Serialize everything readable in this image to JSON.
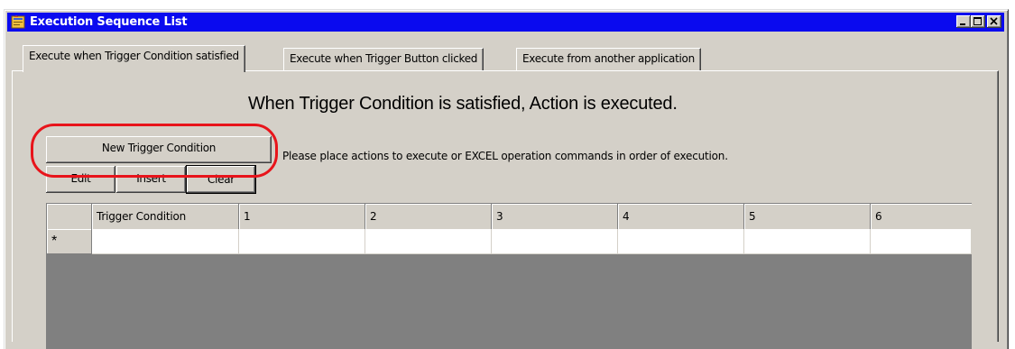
{
  "window": {
    "title": "Execution Sequence List",
    "icon": "app-icon",
    "controls": [
      "minimize-icon",
      "maximize-icon",
      "close-icon"
    ]
  },
  "tabs": [
    {
      "label": "Execute when Trigger Condition satisfied",
      "active": true
    },
    {
      "label": "Execute when Trigger Button clicked",
      "active": false
    },
    {
      "label": "Execute from another application",
      "active": false
    }
  ],
  "panel": {
    "heading": "When Trigger Condition is satisfied, Action is executed.",
    "instruction": "Please place actions to execute or EXCEL operation commands in order of execution."
  },
  "buttons": {
    "new_trigger": "New Trigger Condition",
    "edit": "Edit",
    "insert": "Insert",
    "clear": "Clear"
  },
  "grid": {
    "columns": [
      "Trigger Condition",
      "1",
      "2",
      "3",
      "4",
      "5",
      "6"
    ],
    "new_row_marker": "*"
  },
  "colors": {
    "titlebar": "#0a0aef",
    "highlight": "#e8141b",
    "face": "#d4d0c8",
    "grid_empty": "#808080"
  }
}
